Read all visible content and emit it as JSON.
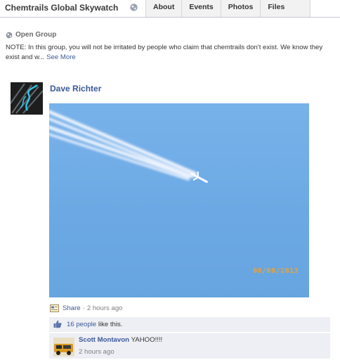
{
  "group": {
    "title": "Chemtrails Global Skywatch",
    "tabs": [
      "About",
      "Events",
      "Photos",
      "Files"
    ],
    "privacy": "Open Group",
    "note": "NOTE: In this group, you will not be irritated by people who claim that chemtrails don't exist. We know they exist and w...",
    "see_more": "See More"
  },
  "post": {
    "author": "Dave Richter",
    "photo_date_stamp": "08/08/2013",
    "share_label": "Share",
    "separator": "·",
    "time": "2 hours ago",
    "likes_link": "16 people",
    "likes_suffix": " like this."
  },
  "comment": {
    "author": "Scott Montavon",
    "text": "YAHOO!!!!",
    "time": "2 hours ago"
  },
  "colors": {
    "link": "#3b5998",
    "sky": "#6ca9e4",
    "date_stamp": "#e8a23a",
    "comment_bg": "#edeff4"
  },
  "icons": [
    "globe-icon",
    "share-icon",
    "like-icon"
  ]
}
